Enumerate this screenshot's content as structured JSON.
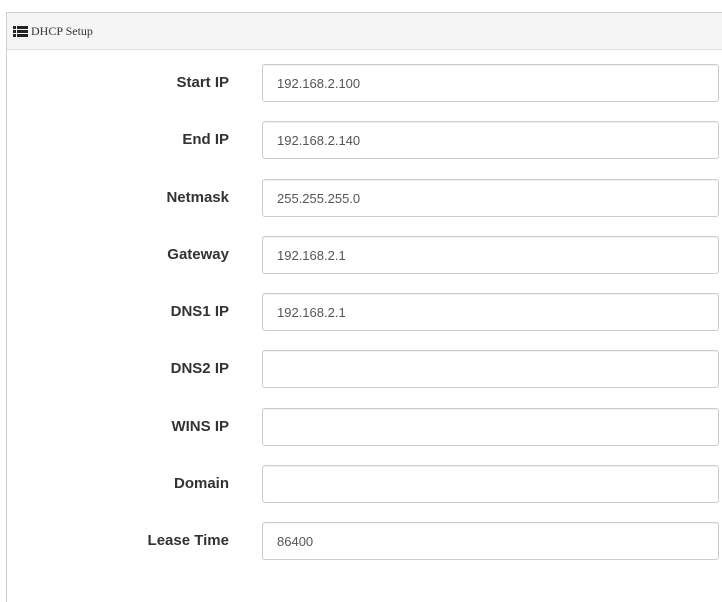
{
  "panel": {
    "title": "DHCP Setup",
    "icon": "list-icon"
  },
  "fields": [
    {
      "label": "Start IP",
      "value": "192.168.2.100"
    },
    {
      "label": "End IP",
      "value": "192.168.2.140"
    },
    {
      "label": "Netmask",
      "value": "255.255.255.0"
    },
    {
      "label": "Gateway",
      "value": "192.168.2.1"
    },
    {
      "label": "DNS1 IP",
      "value": "192.168.2.1"
    },
    {
      "label": "DNS2 IP",
      "value": ""
    },
    {
      "label": "WINS IP",
      "value": ""
    },
    {
      "label": "Domain",
      "value": ""
    },
    {
      "label": "Lease Time",
      "value": "86400"
    }
  ]
}
